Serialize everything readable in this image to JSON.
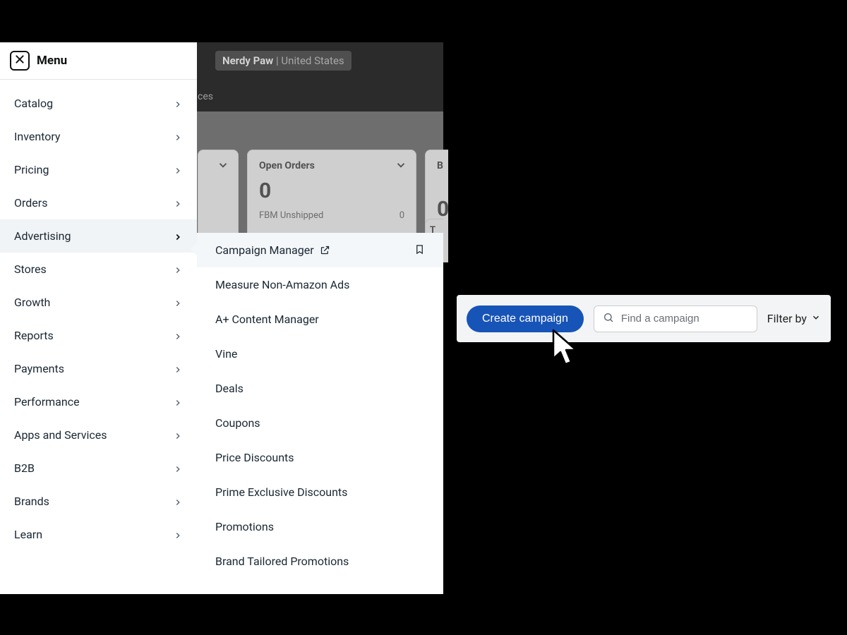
{
  "header": {
    "menu_label": "Menu",
    "store_name": "Nerdy Paw",
    "store_region": "United States",
    "subtitle_fragment": "ces"
  },
  "sidebar": {
    "items": [
      {
        "label": "Catalog"
      },
      {
        "label": "Inventory"
      },
      {
        "label": "Pricing"
      },
      {
        "label": "Orders"
      },
      {
        "label": "Advertising",
        "active": true
      },
      {
        "label": "Stores"
      },
      {
        "label": "Growth"
      },
      {
        "label": "Reports"
      },
      {
        "label": "Payments"
      },
      {
        "label": "Performance"
      },
      {
        "label": "Apps and Services"
      },
      {
        "label": "B2B"
      },
      {
        "label": "Brands"
      },
      {
        "label": "Learn"
      }
    ]
  },
  "submenu": {
    "items": [
      {
        "label": "Campaign Manager",
        "external": true,
        "bookmark": true,
        "active": true
      },
      {
        "label": "Measure Non-Amazon Ads"
      },
      {
        "label": "A+ Content Manager"
      },
      {
        "label": "Vine"
      },
      {
        "label": "Deals"
      },
      {
        "label": "Coupons"
      },
      {
        "label": "Price Discounts"
      },
      {
        "label": "Prime Exclusive Discounts"
      },
      {
        "label": "Promotions"
      },
      {
        "label": "Brand Tailored Promotions"
      }
    ]
  },
  "dashboard": {
    "cardB": {
      "title": "Open Orders",
      "value": "0",
      "row_label": "FBM Unshipped",
      "row_value": "0"
    },
    "cardC": {
      "title_fragment": "B",
      "value_fragment": "0",
      "strip_fragment": "T"
    }
  },
  "toolbar": {
    "create_label": "Create campaign",
    "search_placeholder": "Find a campaign",
    "filter_label": "Filter by"
  }
}
